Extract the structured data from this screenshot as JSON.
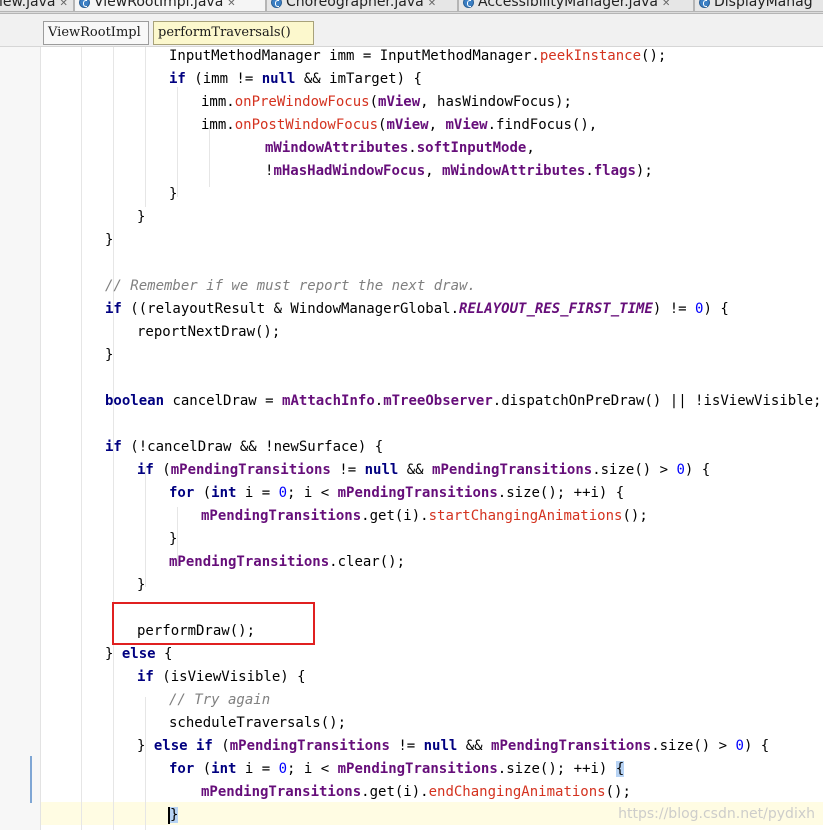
{
  "tabs": [
    {
      "label": "iew.java",
      "active": false
    },
    {
      "label": "ViewRootImpl.java",
      "active": true
    },
    {
      "label": "Choreographer.java",
      "active": false
    },
    {
      "label": "AccessibilityManager.java",
      "active": false
    },
    {
      "label": "DisplayManag",
      "active": false
    }
  ],
  "breadcrumb": {
    "class_name": "ViewRootImpl",
    "method_name": "performTraversals()"
  },
  "code_lines": [
    {
      "indent": 4,
      "tokens": [
        [
          "",
          "InputMethodManager imm = InputMethodManager."
        ],
        [
          "mth",
          "peekInstance"
        ],
        [
          "",
          "();"
        ]
      ]
    },
    {
      "indent": 4,
      "tokens": [
        [
          "kw",
          "if"
        ],
        [
          "",
          " (imm != "
        ],
        [
          "kw",
          "null"
        ],
        [
          "",
          " && imTarget) {"
        ]
      ]
    },
    {
      "indent": 5,
      "tokens": [
        [
          "",
          "imm."
        ],
        [
          "mth",
          "onPreWindowFocus"
        ],
        [
          "",
          "("
        ],
        [
          "fld",
          "mView"
        ],
        [
          "",
          ", hasWindowFocus);"
        ]
      ]
    },
    {
      "indent": 5,
      "tokens": [
        [
          "",
          "imm."
        ],
        [
          "mth",
          "onPostWindowFocus"
        ],
        [
          "",
          "("
        ],
        [
          "fld",
          "mView"
        ],
        [
          "",
          ", "
        ],
        [
          "fld",
          "mView"
        ],
        [
          "",
          ".findFocus(),"
        ]
      ]
    },
    {
      "indent": 7,
      "tokens": [
        [
          "fld",
          "mWindowAttributes"
        ],
        [
          "",
          "."
        ],
        [
          "fld",
          "softInputMode"
        ],
        [
          "",
          ","
        ]
      ]
    },
    {
      "indent": 7,
      "tokens": [
        [
          "",
          "!"
        ],
        [
          "fld",
          "mHasHadWindowFocus"
        ],
        [
          "",
          ", "
        ],
        [
          "fld",
          "mWindowAttributes"
        ],
        [
          "",
          "."
        ],
        [
          "fld",
          "flags"
        ],
        [
          "",
          ");"
        ]
      ]
    },
    {
      "indent": 4,
      "tokens": [
        [
          "",
          "}"
        ]
      ]
    },
    {
      "indent": 3,
      "tokens": [
        [
          "",
          "}"
        ]
      ]
    },
    {
      "indent": 2,
      "tokens": [
        [
          "",
          "}"
        ]
      ]
    },
    {
      "indent": 0,
      "tokens": []
    },
    {
      "indent": 2,
      "tokens": [
        [
          "cmt",
          "// Remember if we must report the next draw."
        ]
      ]
    },
    {
      "indent": 2,
      "tokens": [
        [
          "kw",
          "if"
        ],
        [
          "",
          " ((relayoutResult & WindowManagerGlobal."
        ],
        [
          "cst",
          "RELAYOUT_RES_FIRST_TIME"
        ],
        [
          "",
          ") != "
        ],
        [
          "num",
          "0"
        ],
        [
          "",
          ") {"
        ]
      ]
    },
    {
      "indent": 3,
      "tokens": [
        [
          "",
          "reportNextDraw();"
        ]
      ]
    },
    {
      "indent": 2,
      "tokens": [
        [
          "",
          "}"
        ]
      ]
    },
    {
      "indent": 0,
      "tokens": []
    },
    {
      "indent": 2,
      "tokens": [
        [
          "kw",
          "boolean"
        ],
        [
          "",
          " cancelDraw = "
        ],
        [
          "fld",
          "mAttachInfo"
        ],
        [
          "",
          "."
        ],
        [
          "fld",
          "mTreeObserver"
        ],
        [
          "",
          ".dispatchOnPreDraw() || !isViewVisible;"
        ]
      ]
    },
    {
      "indent": 0,
      "tokens": []
    },
    {
      "indent": 2,
      "tokens": [
        [
          "kw",
          "if"
        ],
        [
          "",
          " (!cancelDraw && !newSurface) {"
        ]
      ]
    },
    {
      "indent": 3,
      "tokens": [
        [
          "kw",
          "if"
        ],
        [
          "",
          " ("
        ],
        [
          "fld",
          "mPendingTransitions"
        ],
        [
          "",
          " != "
        ],
        [
          "kw",
          "null"
        ],
        [
          "",
          " && "
        ],
        [
          "fld",
          "mPendingTransitions"
        ],
        [
          "",
          ".size() > "
        ],
        [
          "num",
          "0"
        ],
        [
          "",
          ") {"
        ]
      ]
    },
    {
      "indent": 4,
      "tokens": [
        [
          "kw",
          "for"
        ],
        [
          "",
          " ("
        ],
        [
          "kw",
          "int"
        ],
        [
          "",
          " i = "
        ],
        [
          "num",
          "0"
        ],
        [
          "",
          "; i < "
        ],
        [
          "fld",
          "mPendingTransitions"
        ],
        [
          "",
          ".size(); ++i) {"
        ]
      ]
    },
    {
      "indent": 5,
      "tokens": [
        [
          "fld",
          "mPendingTransitions"
        ],
        [
          "",
          ".get(i)."
        ],
        [
          "mth",
          "startChangingAnimations"
        ],
        [
          "",
          "();"
        ]
      ]
    },
    {
      "indent": 4,
      "tokens": [
        [
          "",
          "}"
        ]
      ]
    },
    {
      "indent": 4,
      "tokens": [
        [
          "fld",
          "mPendingTransitions"
        ],
        [
          "",
          ".clear();"
        ]
      ]
    },
    {
      "indent": 3,
      "tokens": [
        [
          "",
          "}"
        ]
      ]
    },
    {
      "indent": 0,
      "tokens": []
    },
    {
      "indent": 3,
      "tokens": [
        [
          "",
          "performDraw();"
        ]
      ]
    },
    {
      "indent": 2,
      "tokens": [
        [
          "",
          "} "
        ],
        [
          "kw",
          "else"
        ],
        [
          "",
          " {"
        ]
      ]
    },
    {
      "indent": 3,
      "tokens": [
        [
          "kw",
          "if"
        ],
        [
          "",
          " (isViewVisible) {"
        ]
      ]
    },
    {
      "indent": 4,
      "tokens": [
        [
          "cmt",
          "// Try again"
        ]
      ]
    },
    {
      "indent": 4,
      "tokens": [
        [
          "",
          "scheduleTraversals();"
        ]
      ]
    },
    {
      "indent": 3,
      "tokens": [
        [
          "",
          "} "
        ],
        [
          "kw",
          "else if"
        ],
        [
          "",
          " ("
        ],
        [
          "fld",
          "mPendingTransitions"
        ],
        [
          "",
          " != "
        ],
        [
          "kw",
          "null"
        ],
        [
          "",
          " && "
        ],
        [
          "fld",
          "mPendingTransitions"
        ],
        [
          "",
          ".size() > "
        ],
        [
          "num",
          "0"
        ],
        [
          "",
          ") {"
        ]
      ]
    },
    {
      "indent": 4,
      "tokens": [
        [
          "kw",
          "for"
        ],
        [
          "",
          " ("
        ],
        [
          "kw",
          "int"
        ],
        [
          "",
          " i = "
        ],
        [
          "num",
          "0"
        ],
        [
          "",
          "; i < "
        ],
        [
          "fld",
          "mPendingTransitions"
        ],
        [
          "",
          ".size(); ++i) "
        ],
        [
          "hl",
          "{"
        ]
      ]
    },
    {
      "indent": 5,
      "tokens": [
        [
          "fld",
          "mPendingTransitions"
        ],
        [
          "",
          ".get(i)."
        ],
        [
          "mth",
          "endChangingAnimations"
        ],
        [
          "",
          "();"
        ]
      ]
    },
    {
      "indent": 4,
      "tokens": [
        [
          "caret",
          ""
        ],
        [
          "hl",
          "}"
        ]
      ]
    }
  ],
  "watermark": "https://blog.csdn.net/pydixh",
  "colors": {
    "keyword": "#000080",
    "field": "#660e7a",
    "method_call": "#d4321f",
    "number": "#0000ff",
    "comment": "#808080",
    "highlight_box": "#e02020",
    "current_line": "#fffce3"
  }
}
